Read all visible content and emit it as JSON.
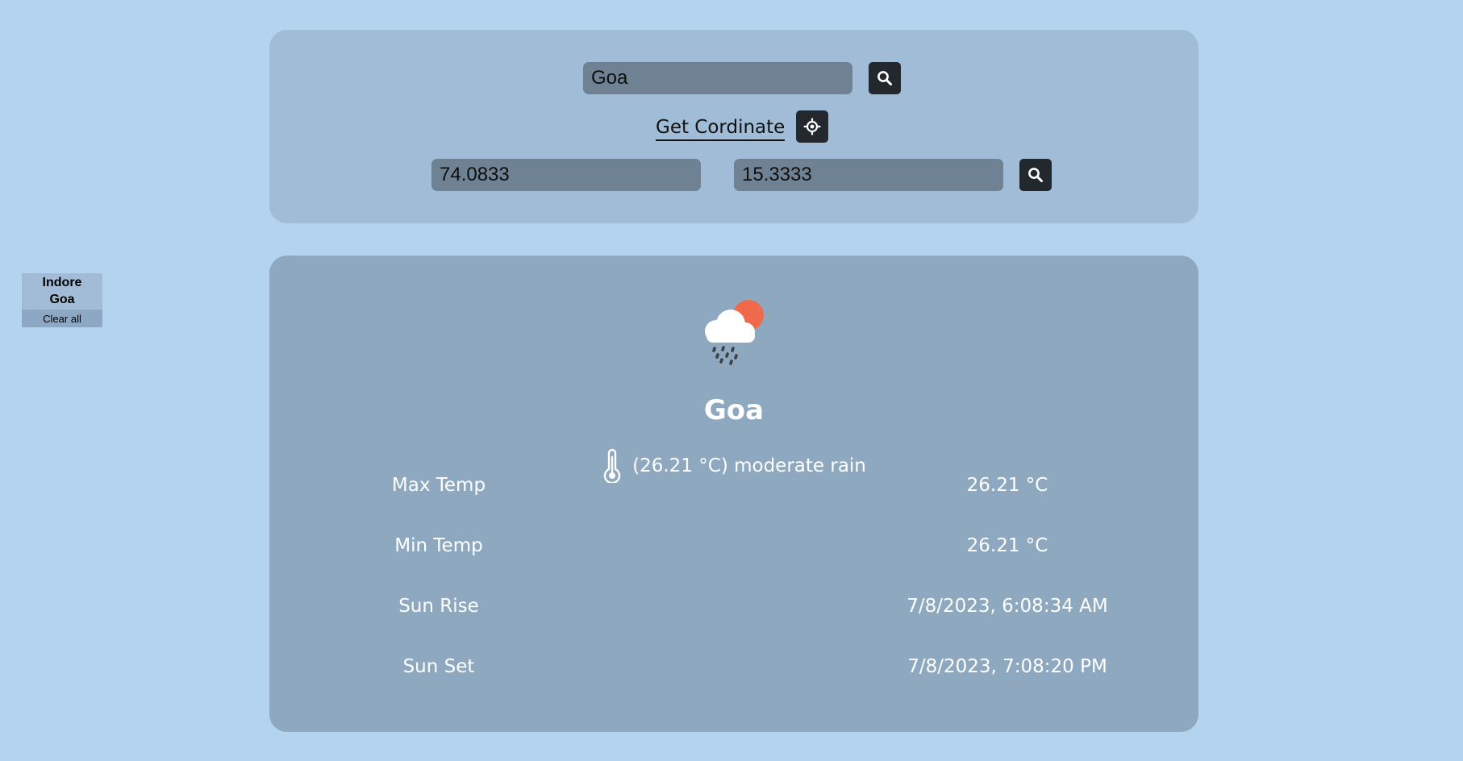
{
  "history": {
    "items": [
      "Indore",
      "Goa"
    ],
    "clear_label": "Clear all"
  },
  "search": {
    "city_value": "Goa",
    "get_coordinate_label": "Get Cordinate",
    "longitude_value": "74.0833",
    "latitude_value": "15.3333",
    "icons": {
      "city_search": "search-icon",
      "locate": "crosshair-icon",
      "coord_search": "search-icon"
    }
  },
  "weather": {
    "icon": "cloud-sun-rain-icon",
    "city": "Goa",
    "temperature": "26.21 °C",
    "description": "moderate rain",
    "stats": [
      {
        "label": "Max Temp",
        "value": "26.21 °C"
      },
      {
        "label": "Min Temp",
        "value": "26.21 °C"
      },
      {
        "label": "Sun Rise",
        "value": "7/8/2023, 6:08:34 AM"
      },
      {
        "label": "Sun Set",
        "value": "7/8/2023, 7:08:20 PM"
      }
    ]
  },
  "colors": {
    "page_bg": "#b3d3ef",
    "search_panel_bg": "#a0bcd6",
    "card_bg": "#8ea9bf",
    "input_bg": "#6f8294",
    "button_bg": "#23272e",
    "sun": "#ee6a4a"
  }
}
